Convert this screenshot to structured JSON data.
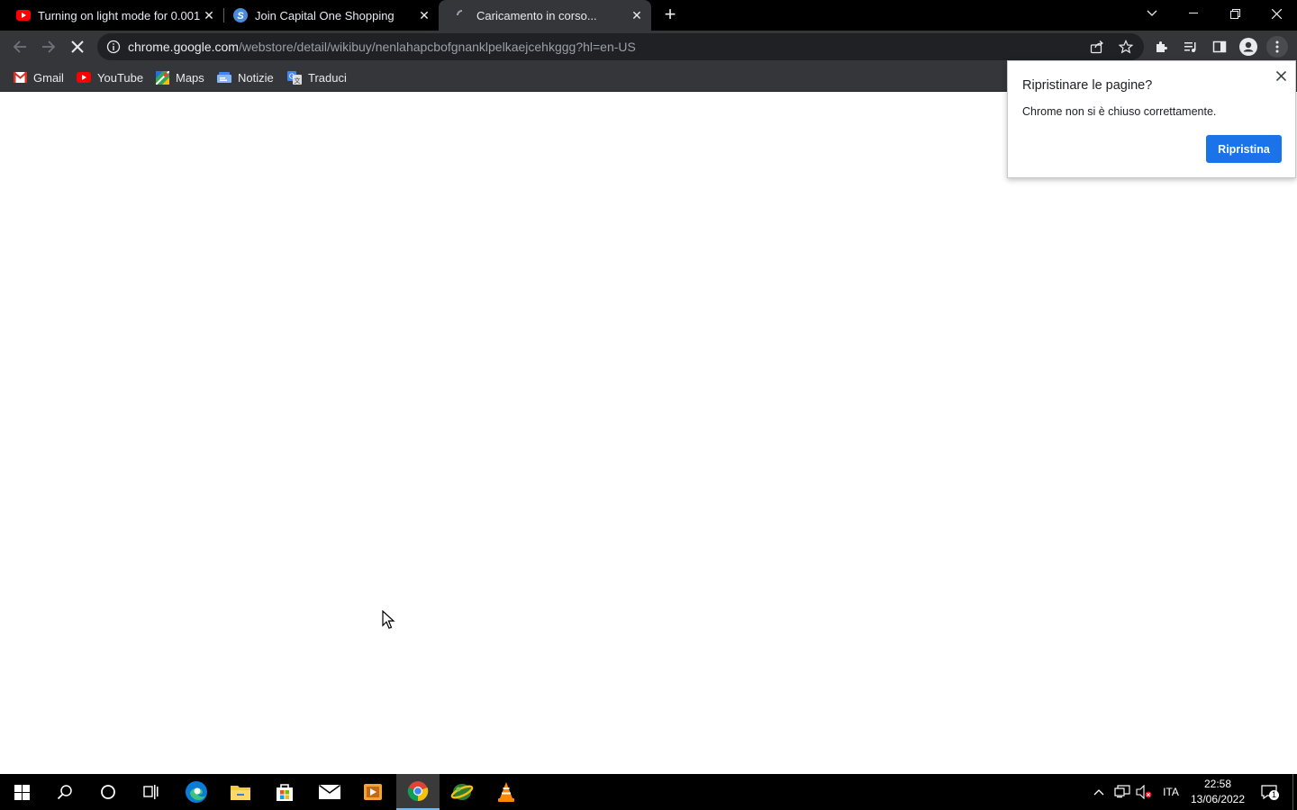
{
  "tabs": [
    {
      "title": "Turning on light mode for 0.001",
      "favicon": "youtube-icon",
      "active": false
    },
    {
      "title": "Join Capital One Shopping",
      "favicon": "capital-one-shopping-icon",
      "active": false
    },
    {
      "title": "Caricamento in corso...",
      "favicon": "loading-spinner-icon",
      "active": true
    }
  ],
  "toolbar": {
    "url_host": "chrome.google.com",
    "url_path": "/webstore/detail/wikibuy/nenlahapcbofgnanklpelkaejcehkggg?hl=en-US"
  },
  "bookmarks": [
    {
      "label": "Gmail",
      "icon": "gmail-icon"
    },
    {
      "label": "YouTube",
      "icon": "youtube-icon"
    },
    {
      "label": "Maps",
      "icon": "maps-icon"
    },
    {
      "label": "Notizie",
      "icon": "news-icon"
    },
    {
      "label": "Traduci",
      "icon": "translate-icon"
    }
  ],
  "restore_bubble": {
    "title": "Ripristinare le pagine?",
    "text": "Chrome non si è chiuso correttamente.",
    "button": "Ripristina"
  },
  "taskbar": {
    "language": "ITA",
    "time": "22:58",
    "date": "13/06/2022",
    "notification_count": "1"
  },
  "colors": {
    "tabstrip_bg": "#000000",
    "toolbar_bg": "#35363a",
    "omnibox_bg": "#202124",
    "accent_button": "#1a73e8",
    "taskbar_bg": "#000000"
  }
}
